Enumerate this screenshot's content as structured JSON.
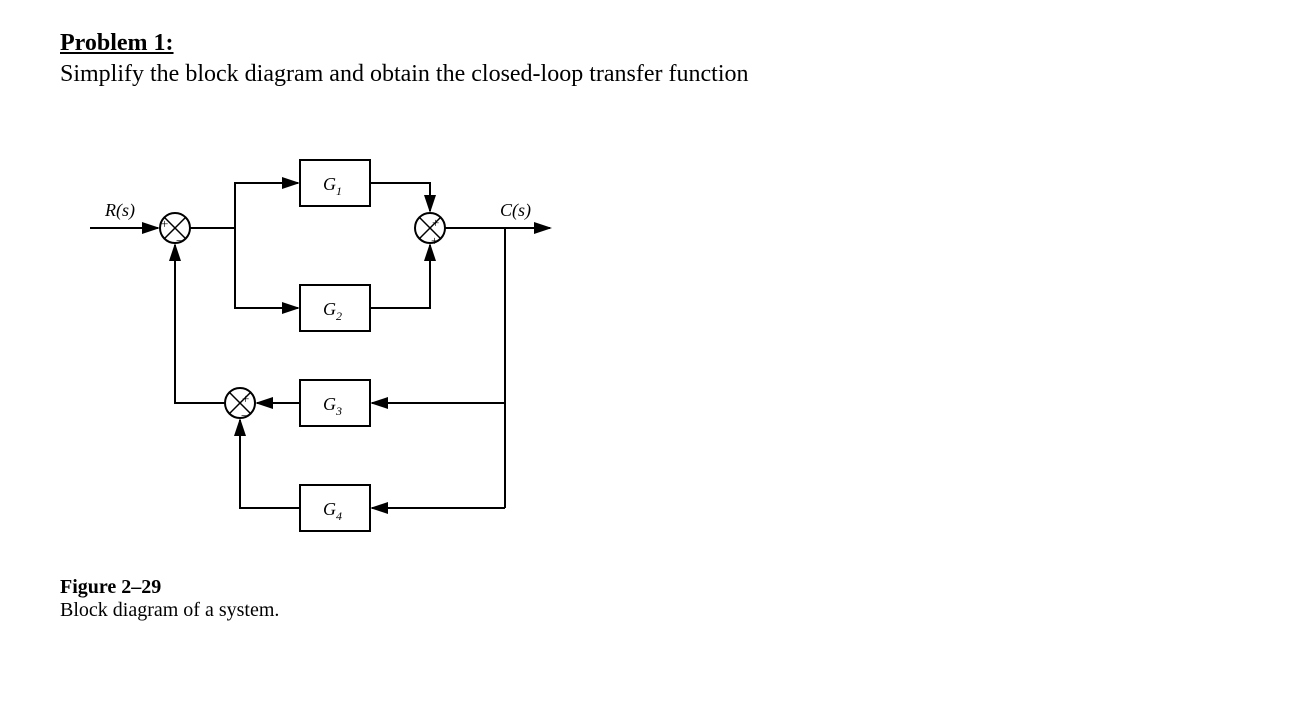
{
  "heading_label": "Problem 1:",
  "instruction": "Simplify the block diagram and obtain the closed-loop transfer function",
  "diagram": {
    "input_label": "R(s)",
    "output_label": "C(s)",
    "blocks": {
      "g1": "G",
      "g1_sub": "1",
      "g2": "G",
      "g2_sub": "2",
      "g3": "G",
      "g3_sub": "3",
      "g4": "G",
      "g4_sub": "4"
    },
    "sum1": {
      "top_right": "+",
      "bottom_left": "−"
    },
    "sum2": {
      "top_left": "+",
      "bottom_left": "+"
    },
    "sum3": {
      "top_right": "+",
      "bottom_left": "−"
    }
  },
  "figure_label": "Figure 2–29",
  "figure_caption": "Block diagram of a system."
}
